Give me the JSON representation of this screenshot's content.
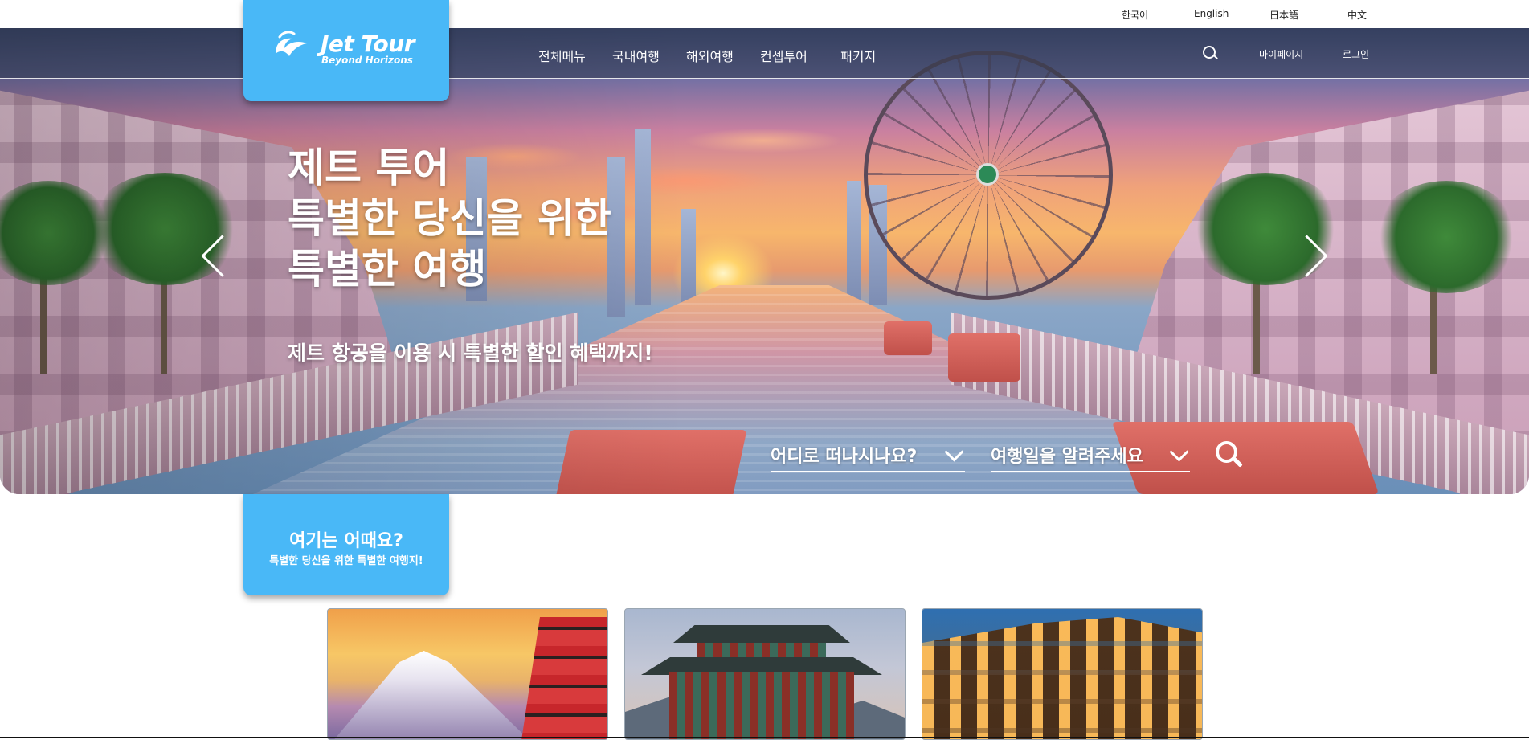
{
  "languages": [
    "한국어",
    "English",
    "日本語",
    "中文"
  ],
  "logo": {
    "title": "Jet Tour",
    "subtitle": "Beyond Horizons"
  },
  "nav": {
    "items": [
      "전체메뉴",
      "국내여행",
      "해외여행",
      "컨셉투어",
      "패키지"
    ],
    "mypage": "마이페이지",
    "login": "로그인",
    "search_icon": "search-icon"
  },
  "hero": {
    "headline": [
      "제트 투어",
      "특별한 당신을 위한",
      "특별한 여행"
    ],
    "subline": "제트 항공을 이용 시 특별한 할인 혜택까지!",
    "destination_label": "어디로 떠나시나요?",
    "date_label": "여행일을 알려주세요",
    "prev_icon": "chevron-left-icon",
    "next_icon": "chevron-right-icon"
  },
  "section": {
    "title": "여기는 어때요?",
    "subtitle": "특별한 당신을 위한 특별한 여행지!"
  },
  "colors": {
    "accent": "#49b8f7",
    "white": "#ffffff"
  }
}
